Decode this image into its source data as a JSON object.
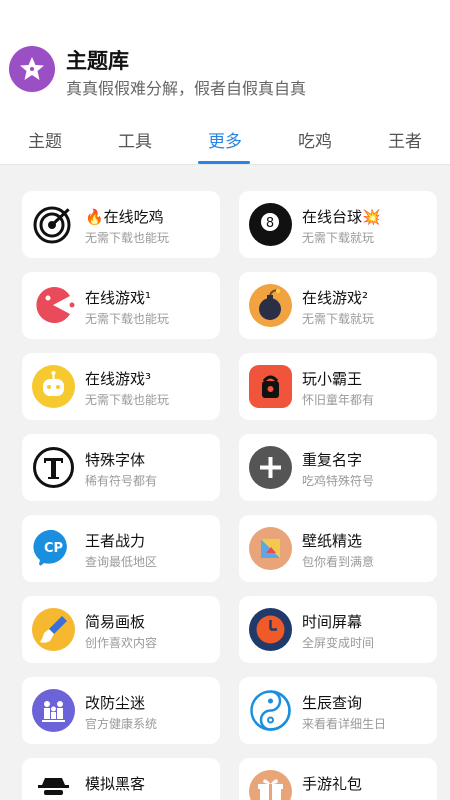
{
  "header": {
    "title": "主题库",
    "subtitle": "真真假假难分解，假者自假真自真"
  },
  "tabs": [
    {
      "label": "主题"
    },
    {
      "label": "工具"
    },
    {
      "label": "更多"
    },
    {
      "label": "吃鸡"
    },
    {
      "label": "王者"
    }
  ],
  "active_tab": "更多",
  "colors": {
    "accent": "#2a82e4",
    "logo": "#9b4fc4"
  },
  "cards": [
    {
      "title": "🔥在线吃鸡",
      "desc": "无需下载也能玩",
      "icon": "target-icon"
    },
    {
      "title": "在线台球💥",
      "desc": "无需下载就玩",
      "icon": "billiard-ball-icon"
    },
    {
      "title": "在线游戏¹",
      "desc": "无需下载也能玩",
      "icon": "pacman-icon"
    },
    {
      "title": "在线游戏²",
      "desc": "无需下载就玩",
      "icon": "bomb-icon"
    },
    {
      "title": "在线游戏³",
      "desc": "无需下载也能玩",
      "icon": "robot-icon"
    },
    {
      "title": "玩小霸王",
      "desc": "怀旧童年都有",
      "icon": "game-console-icon"
    },
    {
      "title": "特殊字体",
      "desc": "稀有符号都有",
      "icon": "font-t-icon"
    },
    {
      "title": "重复名字",
      "desc": "吃鸡特殊符号",
      "icon": "plus-icon"
    },
    {
      "title": "王者战力",
      "desc": "查询最低地区",
      "icon": "cp-chat-icon"
    },
    {
      "title": "壁纸精选",
      "desc": "包你看到满意",
      "icon": "wallpaper-icon"
    },
    {
      "title": "简易画板",
      "desc": "创作喜欢内容",
      "icon": "paintbrush-icon"
    },
    {
      "title": "时间屏幕",
      "desc": "全屏变成时间",
      "icon": "clock-icon"
    },
    {
      "title": "改防尘迷",
      "desc": "官方健康系统",
      "icon": "family-icon"
    },
    {
      "title": "生辰查询",
      "desc": "来看看详细生日",
      "icon": "yin-yang-icon"
    },
    {
      "title": "模拟黑客",
      "desc": "",
      "icon": "hacker-icon"
    },
    {
      "title": "手游礼包",
      "desc": "",
      "icon": "gift-icon"
    }
  ]
}
